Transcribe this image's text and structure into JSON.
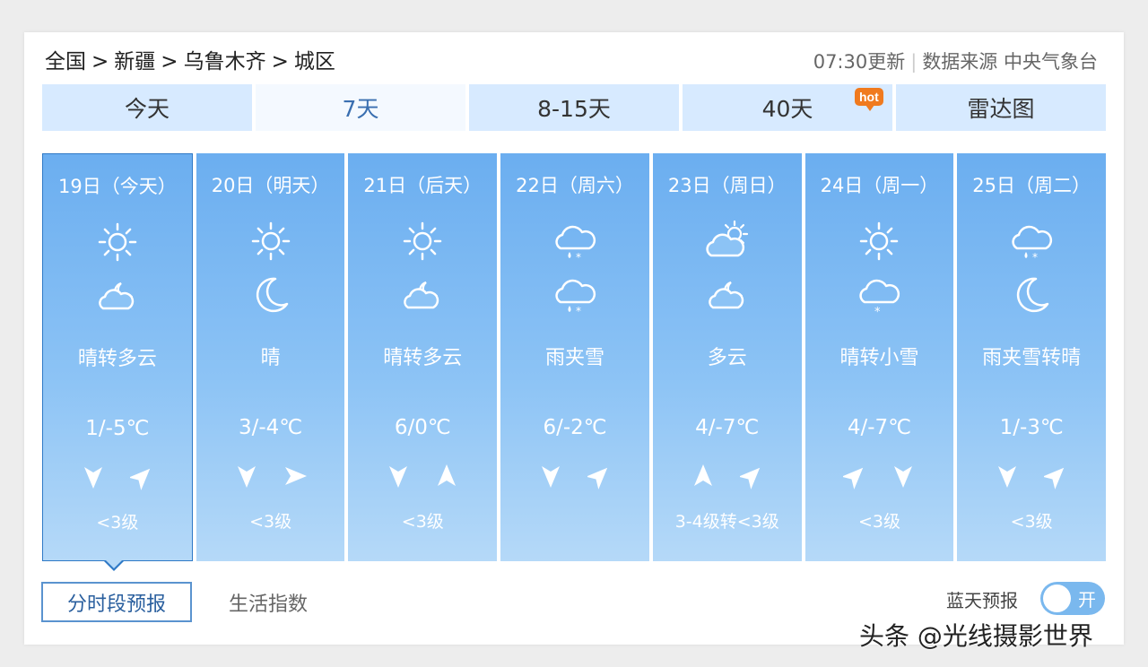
{
  "breadcrumb": [
    "全国",
    "新疆",
    "乌鲁木齐",
    "城区"
  ],
  "breadcrumb_sep": ">",
  "header": {
    "update_time": "07:30更新",
    "source": "数据来源 中央气象台"
  },
  "tabs": [
    {
      "label": "今天"
    },
    {
      "label": "7天",
      "active": true
    },
    {
      "label": "8-15天"
    },
    {
      "label": "40天",
      "badge": "hot"
    },
    {
      "label": "雷达图"
    }
  ],
  "days": [
    {
      "date": "19日（今天）",
      "day_icon": "sun-icon",
      "night_icon": "cloud-moon-icon",
      "desc": "晴转多云",
      "temp": "1/-5℃",
      "wind1": "wind-north-icon",
      "wind2": "wind-northwest-icon",
      "level": "<3级",
      "today": true
    },
    {
      "date": "20日（明天）",
      "day_icon": "sun-icon",
      "night_icon": "moon-icon",
      "desc": "晴",
      "temp": "3/-4℃",
      "wind1": "wind-north-icon",
      "wind2": "wind-east-icon",
      "level": "<3级"
    },
    {
      "date": "21日（后天）",
      "day_icon": "sun-icon",
      "night_icon": "cloud-moon-icon",
      "desc": "晴转多云",
      "temp": "6/0℃",
      "wind1": "wind-north-icon",
      "wind2": "wind-south-icon",
      "level": "<3级"
    },
    {
      "date": "22日（周六）",
      "day_icon": "sleet-icon",
      "night_icon": "sleet-icon",
      "desc": "雨夹雪",
      "temp": "6/-2℃",
      "wind1": "wind-north-icon",
      "wind2": "wind-northwest-icon",
      "level": ""
    },
    {
      "date": "23日（周日）",
      "day_icon": "cloud-sun-icon",
      "night_icon": "cloud-moon-icon",
      "desc": "多云",
      "temp": "4/-7℃",
      "wind1": "wind-south-icon",
      "wind2": "wind-northwest-icon",
      "level": "3-4级转<3级"
    },
    {
      "date": "24日（周一）",
      "day_icon": "sun-icon",
      "night_icon": "snow-icon",
      "desc": "晴转小雪",
      "temp": "4/-7℃",
      "wind1": "wind-northwest-icon",
      "wind2": "wind-north-icon",
      "level": "<3级"
    },
    {
      "date": "25日（周二）",
      "day_icon": "sleet-icon",
      "night_icon": "moon-icon",
      "desc": "雨夹雪转晴",
      "temp": "1/-3℃",
      "wind1": "wind-north-icon",
      "wind2": "wind-northwest-icon",
      "level": "<3级"
    }
  ],
  "bottom": {
    "tab1": "分时段预报",
    "tab2": "生活指数",
    "bluesky_label": "蓝天预报",
    "toggle_text": "开"
  },
  "watermark": "头条 @光线摄影世界",
  "colors": {
    "accent": "#2f79c6",
    "card_top": "#6baef0",
    "card_bottom": "#b5d9f8",
    "tab_bg": "#d7eaff",
    "hot": "#f07a1e"
  }
}
